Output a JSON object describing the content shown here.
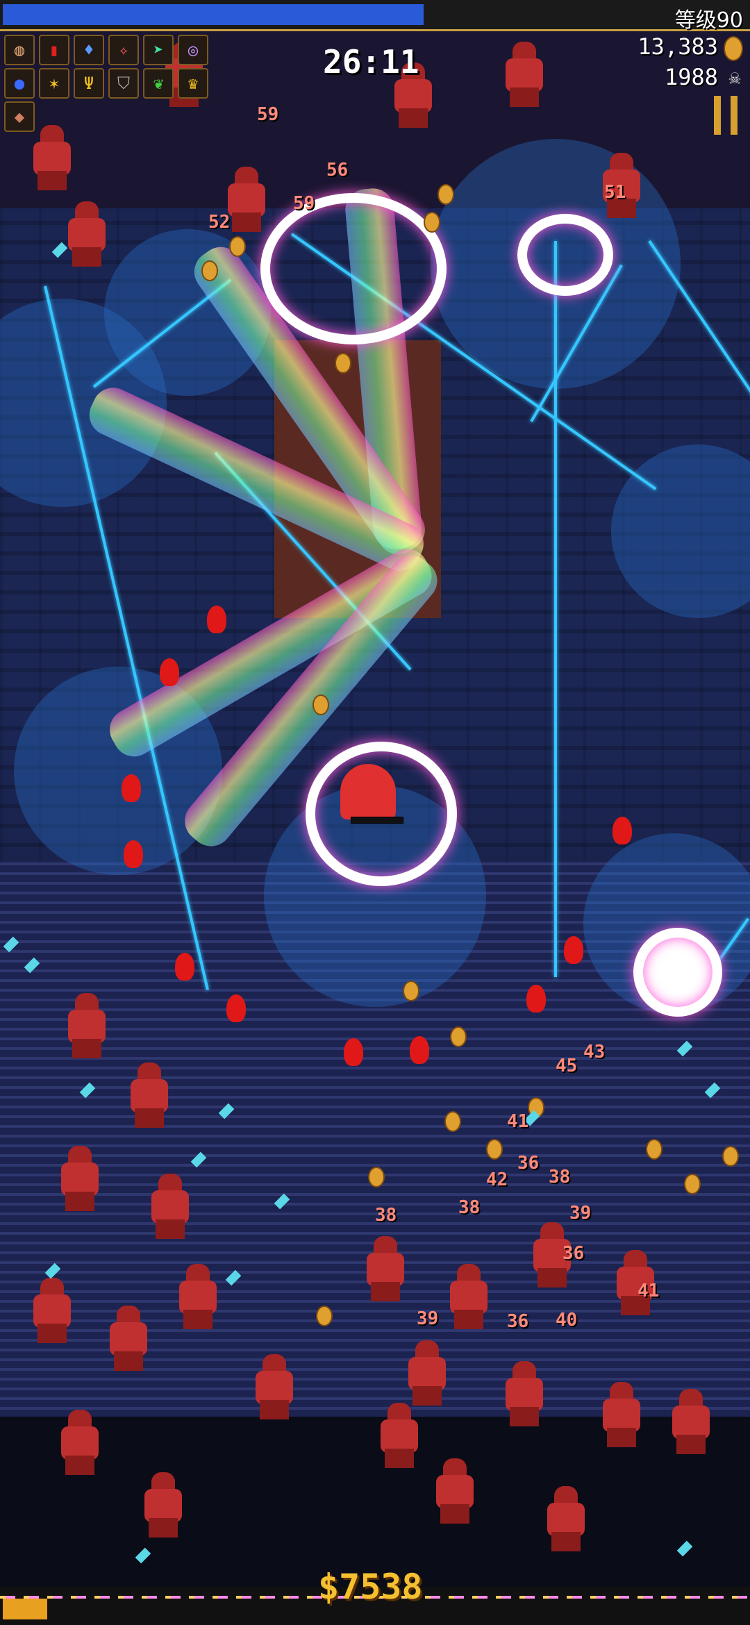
{
  "hud": {
    "level_label": "等级90",
    "xp_progress": 0.565,
    "timer": "26:11",
    "coins": "13,383",
    "kills": "1988",
    "coin_icon": "coin-icon",
    "kill_icon": "skull-icon",
    "pause_icon": "pause-icon"
  },
  "weapons": [
    {
      "icon": "tiramisu-icon",
      "symbol": "◍"
    },
    {
      "icon": "red-book-icon",
      "symbol": "▮"
    },
    {
      "icon": "blue-potion-icon",
      "symbol": "♦"
    },
    {
      "icon": "eye-of-sun-icon",
      "symbol": "✧"
    },
    {
      "icon": "green-arrow-icon",
      "symbol": "➤"
    },
    {
      "icon": "vortex-icon",
      "symbol": "◎"
    }
  ],
  "passives": [
    {
      "icon": "blue-orb-icon",
      "symbol": "●"
    },
    {
      "icon": "yellow-crown-frame-icon",
      "symbol": "✶"
    },
    {
      "icon": "candelabra-icon",
      "symbol": "Ψ"
    },
    {
      "icon": "armor-icon",
      "symbol": "⛉"
    },
    {
      "icon": "clover-icon",
      "symbol": "❦"
    },
    {
      "icon": "crown-icon",
      "symbol": "♛"
    }
  ],
  "extra_slots": [
    {
      "icon": "meat-icon",
      "symbol": "◆"
    }
  ],
  "damage_numbers": [
    "59",
    "51",
    "52",
    "56",
    "59",
    "38",
    "38",
    "41",
    "45",
    "36",
    "39",
    "36",
    "38",
    "39",
    "42",
    "36",
    "40",
    "41",
    "43"
  ],
  "gold_counter": "$7538",
  "gold_progress": 0.06,
  "colors": {
    "xp": "#2b5ad8",
    "gold": "#f5c030",
    "beam": "#35c7ff",
    "enemy": "#c03030"
  }
}
